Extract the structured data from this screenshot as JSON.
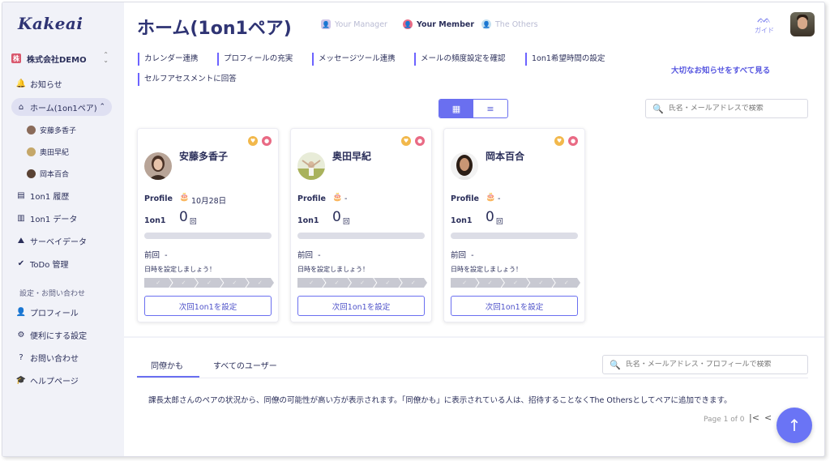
{
  "app": {
    "logo": "Kakeai",
    "company": {
      "badge": "株",
      "name": "株式会社DEMO",
      "toggle_up": "⌃",
      "toggle_down": "⌄"
    }
  },
  "sidebar": {
    "items": [
      {
        "icon": "🔔",
        "label": "お知らせ"
      },
      {
        "icon": "⌂",
        "label": "ホーム(1on1ペア)",
        "chevron": "⌃"
      },
      {
        "icon": "▤",
        "label": "1on1 履歴"
      },
      {
        "icon": "▥",
        "label": "1on1 データ"
      },
      {
        "icon": "⛰",
        "label": "サーベイデータ"
      },
      {
        "icon": "✔",
        "label": "ToDo 管理"
      }
    ],
    "sub_items": [
      {
        "label": "安藤多香子"
      },
      {
        "label": "奥田早紀"
      },
      {
        "label": "岡本百合"
      }
    ],
    "section_label": "設定・お問い合わせ",
    "settings": [
      {
        "icon": "👤",
        "label": "プロフィール"
      },
      {
        "icon": "⚙",
        "label": "便利にする設定"
      },
      {
        "icon": "?",
        "label": "お問い合わせ"
      },
      {
        "icon": "🎓",
        "label": "ヘルプページ"
      }
    ]
  },
  "header": {
    "title": "ホーム(1on1ペア)",
    "roles": [
      {
        "label": "Your Manager"
      },
      {
        "label": "Your Member"
      },
      {
        "label": "The Others"
      }
    ],
    "guide_label": "ガイド",
    "guide_icon": "ᨐ"
  },
  "tasks": [
    {
      "label": "カレンダー連携"
    },
    {
      "label": "プロフィールの充実"
    },
    {
      "label": "メッセージツール連携"
    },
    {
      "label": "メールの頻度設定を確認"
    },
    {
      "label": "1on1希望時間の設定"
    },
    {
      "label": "セルフアセスメントに回答"
    }
  ],
  "all_notices_link": "大切なお知らせをすべて見る",
  "view_toggle": {
    "grid_icon": "▦",
    "list_icon": "≡"
  },
  "member_search": {
    "icon": "🔍",
    "placeholder": "氏名・メールアドレスで検索"
  },
  "cards": [
    {
      "name": "安藤多香子",
      "profile_label": "Profile",
      "cake_icon": "🎂",
      "birthday": "10月28日",
      "oneonone_label": "1on1",
      "count": "0",
      "count_unit": "回",
      "prev_label": "前回",
      "prev_value": "-",
      "prompt": "日時を設定しましょう！",
      "button": "次回1on1を設定"
    },
    {
      "name": "奥田早紀",
      "profile_label": "Profile",
      "cake_icon": "🎂",
      "birthday": "-",
      "oneonone_label": "1on1",
      "count": "0",
      "count_unit": "回",
      "prev_label": "前回",
      "prev_value": "-",
      "prompt": "日時を設定しましょう！",
      "button": "次回1on1を設定"
    },
    {
      "name": "岡本百合",
      "profile_label": "Profile",
      "cake_icon": "🎂",
      "birthday": "-",
      "oneonone_label": "1on1",
      "count": "0",
      "count_unit": "回",
      "prev_label": "前回",
      "prev_value": "-",
      "prompt": "日時を設定しましょう！",
      "button": "次回1on1を設定"
    }
  ],
  "step_check": "✓",
  "lower": {
    "tabs": [
      {
        "label": "同僚かも"
      },
      {
        "label": "すべてのユーザー"
      }
    ],
    "search": {
      "icon": "🔍",
      "placeholder": "氏名・メールアドレス・プロフィールで検索"
    },
    "description": "課長太郎さんのペアの状況から、同僚の可能性が高い方が表示されます。「同僚かも」に表示されている人は、招待することなくThe Othersとしてペアに追加できます。",
    "pager": "Page 1 of 0",
    "first_icon": "|<",
    "prev_icon": "<"
  },
  "fab_icon": "↑",
  "colors": {
    "accent": "#6a6ff0",
    "sidebar_bg": "#f1f2f8",
    "title": "#2f3474",
    "badge_red": "#d9586e",
    "badge_yellow": "#f2b84b",
    "badge_pink": "#e96a84"
  }
}
